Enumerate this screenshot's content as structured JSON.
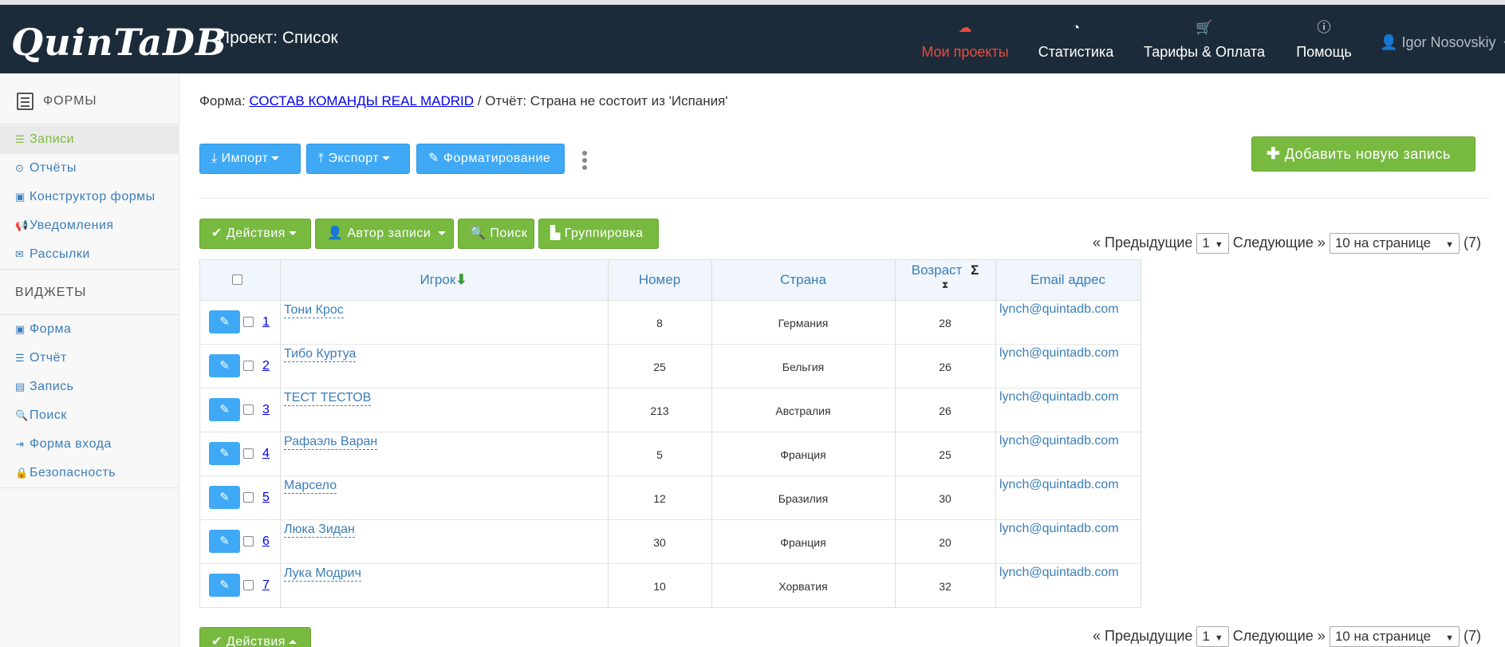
{
  "app": {
    "logo": "QuinTaDB",
    "project_title": "Проект: Список"
  },
  "nav": {
    "items": [
      {
        "label": "Мои проекты",
        "icon": "cloud-icon"
      },
      {
        "label": "Статистика",
        "icon": "pie-chart-icon"
      },
      {
        "label": "Тарифы & Оплата",
        "icon": "cart-icon"
      },
      {
        "label": "Помощь",
        "icon": "info-icon"
      }
    ],
    "user": "Igor Nosovskiy"
  },
  "sidebar": {
    "forms_heading": "ФОРМЫ",
    "items": [
      {
        "label": "Записи",
        "icon": "list-icon"
      },
      {
        "label": "Отчёты",
        "icon": "dot-circle-icon"
      },
      {
        "label": "Конструктор формы",
        "icon": "form-icon"
      },
      {
        "label": "Уведомления",
        "icon": "bullhorn-icon"
      },
      {
        "label": "Рассылки",
        "icon": "envelope-icon"
      }
    ],
    "widgets_heading": "ВИДЖЕТЫ",
    "widgets": [
      {
        "label": "Форма",
        "icon": "form-icon"
      },
      {
        "label": "Отчёт",
        "icon": "list-icon"
      },
      {
        "label": "Запись",
        "icon": "record-icon"
      },
      {
        "label": "Поиск",
        "icon": "search-icon"
      },
      {
        "label": "Форма входа",
        "icon": "sign-in-icon"
      },
      {
        "label": "Безопасность",
        "icon": "lock-icon"
      }
    ]
  },
  "breadcrumb": {
    "prefix": "Форма:",
    "form_link": "СОСТАВ КОМАНДЫ REAL MADRID",
    "suffix": "/ Отчёт: Страна не состоит из 'Испания'"
  },
  "toolbar": {
    "import": "Импорт",
    "export": "Экспорт",
    "format": "Форматирование",
    "add_new": "Добавить новую запись"
  },
  "actions": {
    "actions": "Действия",
    "author": "Автор записи",
    "search": "Поиск",
    "grouping": "Группировка"
  },
  "pager": {
    "prev": "« Предыдущие",
    "page": "1",
    "next": "Следующие »",
    "per_page": "10 на странице",
    "total": "(7)"
  },
  "table": {
    "headers": {
      "player": "Игрок",
      "number": "Номер",
      "country": "Страна",
      "age": "Возраст",
      "email": "Email адрес"
    },
    "rows": [
      {
        "n": "1",
        "player": "Тони Крос",
        "number": "8",
        "country": "Германия",
        "age": "28",
        "email": "lynch@quintadb.com"
      },
      {
        "n": "2",
        "player": "Тибо Куртуа",
        "number": "25",
        "country": "Бельгия",
        "age": "26",
        "email": "lynch@quintadb.com"
      },
      {
        "n": "3",
        "player": "ТЕСТ ТЕСТОВ",
        "number": "213",
        "country": "Австралия",
        "age": "26",
        "email": "lynch@quintadb.com"
      },
      {
        "n": "4",
        "player": "Рафаэль Варан",
        "number": "5",
        "country": "Франция",
        "age": "25",
        "email": "lynch@quintadb.com"
      },
      {
        "n": "5",
        "player": "Марсело",
        "number": "12",
        "country": "Бразилия",
        "age": "30",
        "email": "lynch@quintadb.com"
      },
      {
        "n": "6",
        "player": "Люка Зидан",
        "number": "30",
        "country": "Франция",
        "age": "20",
        "email": "lynch@quintadb.com"
      },
      {
        "n": "7",
        "player": "Лука Модрич",
        "number": "10",
        "country": "Хорватия",
        "age": "32",
        "email": "lynch@quintadb.com"
      }
    ]
  },
  "colors": {
    "navbar": "#1c2b39",
    "accent_red": "#e74c3c",
    "button_blue": "#3fa9f5",
    "button_green": "#78b940",
    "link_blue": "#3b7eb9"
  }
}
